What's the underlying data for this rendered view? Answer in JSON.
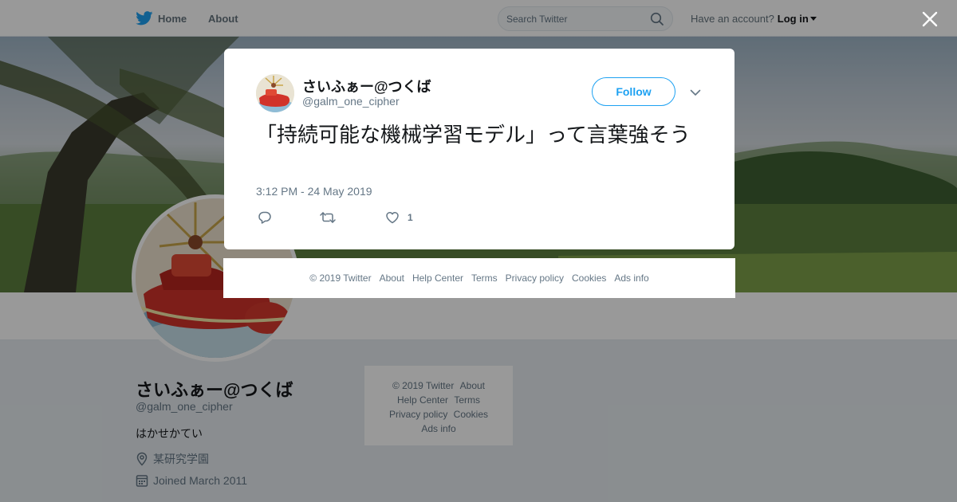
{
  "nav": {
    "home_label": "Home",
    "about_label": "About",
    "search_placeholder": "Search Twitter",
    "account_prompt": "Have an account?",
    "login_label": "Log in"
  },
  "profile": {
    "name": "さいふぁー@つくば",
    "handle": "@galm_one_cipher",
    "bio": "はかせかてい",
    "location": "某研究学園",
    "joined": "Joined March 2011"
  },
  "side_footer": {
    "copyright": "© 2019 Twitter",
    "about": "About",
    "help": "Help Center",
    "terms": "Terms",
    "privacy": "Privacy policy",
    "cookies": "Cookies",
    "ads": "Ads info"
  },
  "tweet": {
    "author_name": "さいふぁー@つくば",
    "author_handle": "@galm_one_cipher",
    "follow_label": "Follow",
    "text": "「持続可能な機械学習モデル」って言葉強そう",
    "timestamp": "3:12 PM - 24 May 2019",
    "like_count": "1"
  },
  "modal_footer": {
    "copyright": "© 2019 Twitter",
    "about": "About",
    "help": "Help Center",
    "terms": "Terms",
    "privacy": "Privacy policy",
    "cookies": "Cookies",
    "ads": "Ads info"
  },
  "icons": {
    "logo": "twitter-bird-icon",
    "search": "search-icon",
    "close": "close-icon",
    "more": "chevron-down-icon",
    "reply": "reply-icon",
    "retweet": "retweet-icon",
    "like": "heart-icon",
    "location": "location-pin-icon",
    "calendar": "calendar-icon"
  },
  "colors": {
    "brand": "#1da1f2",
    "text_primary": "#14171a",
    "text_secondary": "#657786",
    "overlay": "rgba(0,0,0,0.4)"
  }
}
